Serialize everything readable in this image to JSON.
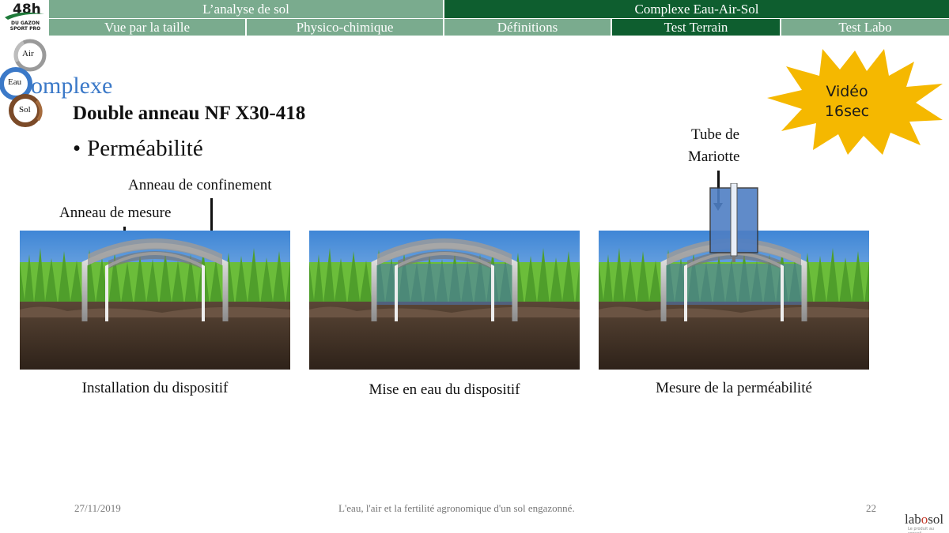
{
  "nav": {
    "top": [
      {
        "label": "L’analyse  de sol",
        "active": false
      },
      {
        "label": "Complexe Eau-Air-Sol",
        "active": true
      }
    ],
    "bottom": [
      {
        "label": "Vue par la taille",
        "active": false
      },
      {
        "label": "Physico-chimique",
        "active": false
      },
      {
        "label": "Définitions",
        "active": false
      },
      {
        "label": "Test Terrain",
        "active": true
      },
      {
        "label": "Test Labo",
        "active": false
      }
    ]
  },
  "logo": {
    "number": "48h",
    "subtitle_line1": "DU GAZON",
    "subtitle_line2": "SPORT PRO"
  },
  "cycle": {
    "air": "Air",
    "eau": "Eau",
    "sol": "Sol",
    "title": "omplexe"
  },
  "slide": {
    "title": "Double anneau NF X30-418",
    "bullet": "Perméabilité"
  },
  "annotations": {
    "confinement": "Anneau de confinement",
    "mesure": "Anneau de mesure",
    "mariotte_line1": "Tube de",
    "mariotte_line2": "Mariotte"
  },
  "captions": [
    "Installation du dispositif",
    "Mise en eau du dispositif",
    "Mesure de la perméabilité"
  ],
  "video": {
    "line1": "Vidéo",
    "line2": "16sec"
  },
  "footer": {
    "date": "27/11/2019",
    "center": "L'eau, l'air  et la fertilité  agronomique  d'un sol engazonné.",
    "page": "22",
    "brand_prefix": "lab",
    "brand_o": "o",
    "brand_suffix": "sol",
    "brand_tagline": "Le produit au conseil"
  },
  "colors": {
    "nav_light": "#7aab8e",
    "nav_dark": "#0e5e2f",
    "complexe_blue": "#3b79c8",
    "burst_yellow": "#f5b800"
  }
}
